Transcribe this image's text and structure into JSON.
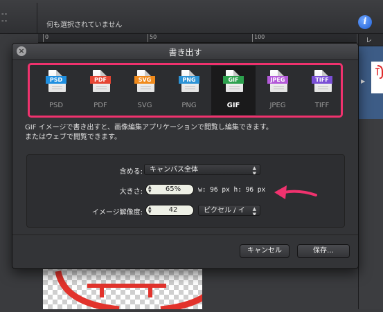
{
  "toolbar": {
    "dashes": "--\n--",
    "selection_status": "何も選択されていません"
  },
  "ruler": {
    "labels": [
      "0",
      "50",
      "100"
    ]
  },
  "dialog": {
    "title": "書き出す",
    "formats": [
      {
        "id": "psd",
        "badge": "PSD",
        "label": "PSD",
        "color": "#1f8fe0",
        "selected": false
      },
      {
        "id": "pdf",
        "badge": "PDF",
        "label": "PDF",
        "color": "#e64533",
        "selected": false
      },
      {
        "id": "svg",
        "badge": "SVG",
        "label": "SVG",
        "color": "#f08a1c",
        "selected": false
      },
      {
        "id": "png",
        "badge": "PNG",
        "label": "PNG",
        "color": "#2c93d6",
        "selected": false
      },
      {
        "id": "gif",
        "badge": "GIF",
        "label": "GIF",
        "color": "#2da14e",
        "selected": true
      },
      {
        "id": "jpeg",
        "badge": "JPEG",
        "label": "JPEG",
        "color": "#b45ad9",
        "selected": false
      },
      {
        "id": "tiff",
        "badge": "TIFF",
        "label": "TIFF",
        "color": "#7a4fd6",
        "selected": false
      }
    ],
    "description_line1": "GIF イメージで書き出すと、画像編集アプリケーションで閲覧し編集できます。",
    "description_line2": "またはウェブで閲覧できます。",
    "include_label": "含める:",
    "include_value": "キャンバス全体",
    "size_label": "大きさ:",
    "size_value": "65%",
    "size_readout": "w: 96 px h: 96 px",
    "resolution_label": "イメージ解像度:",
    "resolution_value": "42",
    "resolution_unit": "ピクセル / イ",
    "cancel_label": "キャンセル",
    "save_label": "保存…",
    "highlight_color": "#f0326e"
  },
  "right_panel": {
    "header": "レ"
  }
}
